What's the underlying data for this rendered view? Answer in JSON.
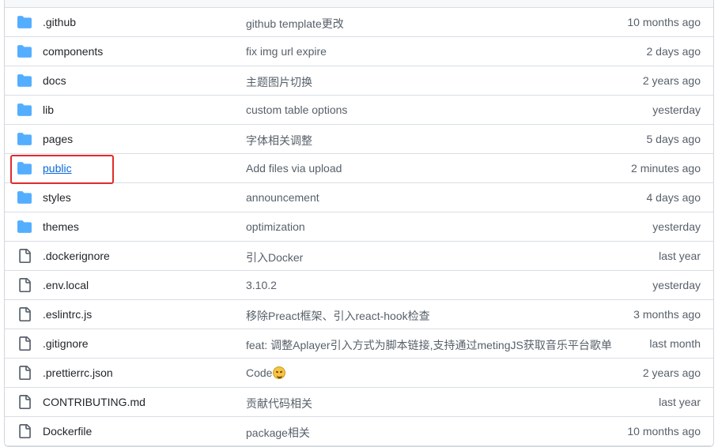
{
  "colors": {
    "folder_icon": "#54aeff",
    "file_icon": "#57606a",
    "link": "#0969da",
    "highlight_border": "#e02b2b"
  },
  "files": [
    {
      "name": ".github",
      "type": "folder",
      "icon": "folder-icon",
      "message": "github template更改",
      "time": "10 months ago"
    },
    {
      "name": "components",
      "type": "folder",
      "icon": "folder-icon",
      "message": "fix img url expire",
      "time": "2 days ago"
    },
    {
      "name": "docs",
      "type": "folder",
      "icon": "folder-icon",
      "message": "主题图片切换",
      "time": "2 years ago"
    },
    {
      "name": "lib",
      "type": "folder",
      "icon": "folder-icon",
      "message": "custom table options",
      "time": "yesterday"
    },
    {
      "name": "pages",
      "type": "folder",
      "icon": "folder-icon",
      "message": "字体相关调整",
      "time": "5 days ago"
    },
    {
      "name": "public",
      "type": "folder",
      "icon": "folder-icon",
      "message": "Add files via upload",
      "time": "2 minutes ago",
      "highlighted": true
    },
    {
      "name": "styles",
      "type": "folder",
      "icon": "folder-icon",
      "message": "announcement",
      "time": "4 days ago"
    },
    {
      "name": "themes",
      "type": "folder",
      "icon": "folder-icon",
      "message": "optimization",
      "time": "yesterday"
    },
    {
      "name": ".dockerignore",
      "type": "file",
      "icon": "file-icon",
      "message": "引入Docker",
      "time": "last year"
    },
    {
      "name": ".env.local",
      "type": "file",
      "icon": "file-icon",
      "message": "3.10.2",
      "time": "yesterday"
    },
    {
      "name": ".eslintrc.js",
      "type": "file",
      "icon": "file-icon",
      "message": "移除Preact框架、引入react-hook检查",
      "time": "3 months ago"
    },
    {
      "name": ".gitignore",
      "type": "file",
      "icon": "file-icon",
      "message": "feat: 调整Aplayer引入方式为脚本链接,支持通过metingJS获取音乐平台歌单",
      "time": "last month"
    },
    {
      "name": ".prettierrc.json",
      "type": "file",
      "icon": "file-icon",
      "message": "Code",
      "message_emoji": "rolling-on-floor-laughing-emoji",
      "time": "2 years ago"
    },
    {
      "name": "CONTRIBUTING.md",
      "type": "file",
      "icon": "file-icon",
      "message": "贡献代码相关",
      "time": "last year"
    },
    {
      "name": "Dockerfile",
      "type": "file",
      "icon": "file-icon",
      "message": "package相关",
      "time": "10 months ago"
    }
  ]
}
